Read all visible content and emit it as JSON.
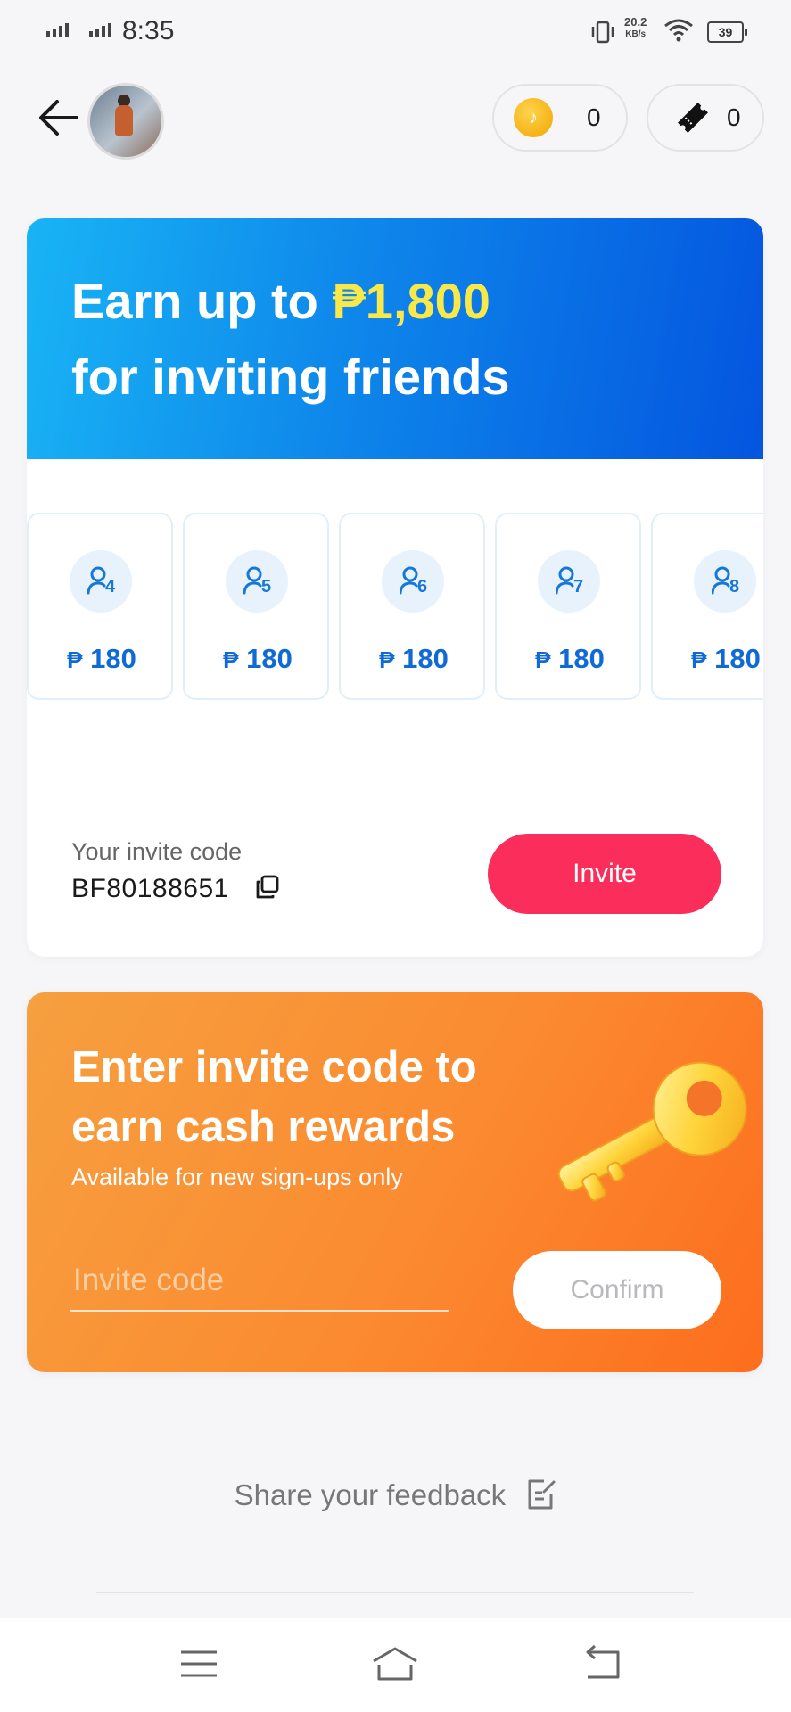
{
  "status_bar": {
    "time": "8:35",
    "net_speed_value": "20.2",
    "net_speed_unit": "KB/s",
    "battery": "39"
  },
  "header": {
    "coins": "0",
    "tickets": "0",
    "coin_symbol": "♪"
  },
  "invite_banner": {
    "line1_prefix": "Earn up to ",
    "amount": "₱1,800",
    "line2": "for inviting friends"
  },
  "tiers": [
    {
      "count": "4",
      "amount": "180",
      "currency": "₱"
    },
    {
      "count": "5",
      "amount": "180",
      "currency": "₱"
    },
    {
      "count": "6",
      "amount": "180",
      "currency": "₱"
    },
    {
      "count": "7",
      "amount": "180",
      "currency": "₱"
    },
    {
      "count": "8",
      "amount": "180",
      "currency": "₱"
    }
  ],
  "my_code": {
    "label": "Your invite code",
    "value": "BF80188651",
    "invite_button": "Invite"
  },
  "enter_code": {
    "title_line1": "Enter invite code to",
    "title_line2": "earn cash rewards",
    "subtitle": "Available for new sign-ups only",
    "placeholder": "Invite code",
    "confirm_button": "Confirm"
  },
  "feedback": {
    "label": "Share your feedback"
  },
  "colors": {
    "brand_blue": "#0e86ea",
    "invite_red": "#fb2d5a",
    "orange": "#fb8a30",
    "amount_yellow": "#f8e84a"
  }
}
